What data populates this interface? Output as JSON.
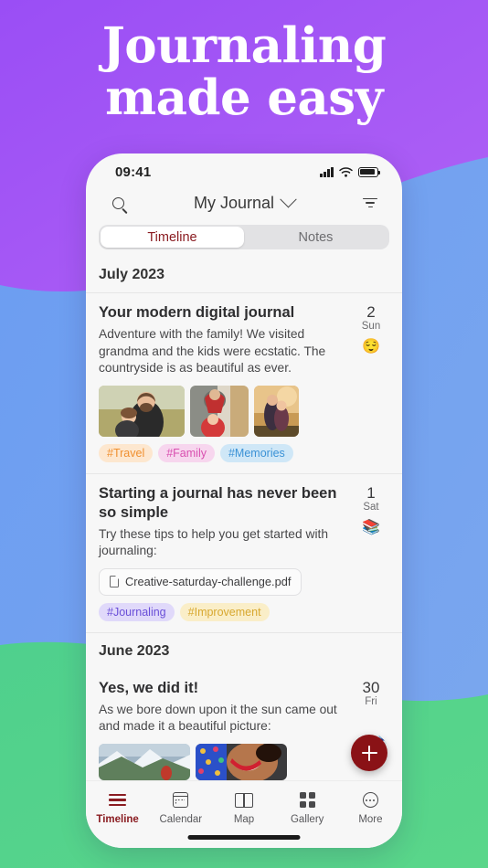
{
  "promo": {
    "headline_line1": "Journaling",
    "headline_line2": "made easy",
    "bg_purple": "#a855f5",
    "bg_blue": "#6f9ef0",
    "bg_green": "#56d189"
  },
  "status_bar": {
    "time": "09:41",
    "icons": [
      "cellular-signal",
      "wifi",
      "battery"
    ]
  },
  "nav": {
    "title": "My Journal",
    "chevron": "chevron-down",
    "search_icon": "search-icon",
    "filter_icon": "filter-icon"
  },
  "segmented": {
    "tabs": [
      {
        "label": "Timeline",
        "active": true
      },
      {
        "label": "Notes",
        "active": false
      }
    ],
    "active_color": "#8a1c21"
  },
  "feed": {
    "sections": [
      {
        "month": "July 2023",
        "entries": [
          {
            "title": "Your modern digital journal",
            "body": "Adventure with the family! We visited grandma and the kids were ecstatic. The countryside is as beautiful as ever.",
            "day_number": "2",
            "day_name": "Sun",
            "mood_emoji": "😌",
            "photos": [
              "family-father-daughter-field",
              "mother-child-kitchen",
              "siblings-sunset-hug"
            ],
            "tags": [
              {
                "label": "#Travel",
                "color": "#f09030",
                "bg": "#fde7cf"
              },
              {
                "label": "#Family",
                "color": "#d94fb0",
                "bg": "#f7d6ee"
              },
              {
                "label": "#Memories",
                "color": "#3b92d6",
                "bg": "#cfe7f7"
              }
            ]
          },
          {
            "title": "Starting a journal has never been so simple",
            "body": "Try these tips to help you get started with journaling:",
            "day_number": "1",
            "day_name": "Sat",
            "mood_emoji": "📚",
            "attachment": "Creative-saturday-challenge.pdf",
            "tags": [
              {
                "label": "#Journaling",
                "color": "#6a4fd8",
                "bg": "#e0d9fa"
              },
              {
                "label": "#Improvement",
                "color": "#d8a830",
                "bg": "#faeec8"
              }
            ]
          }
        ]
      },
      {
        "month": "June 2023",
        "entries": [
          {
            "title": "Yes, we did it!",
            "body": "As we bore down upon it the sun came out and made it a beautiful picture:",
            "day_number": "30",
            "day_name": "Fri",
            "photos": [
              "snowy-mountain-hiker",
              "smiling-woman-portrait"
            ],
            "tags": []
          }
        ]
      }
    ]
  },
  "fab": {
    "label": "+",
    "color": "#8a1216",
    "emoji": "🗻"
  },
  "tabbar": {
    "items": [
      {
        "label": "Timeline",
        "icon": "timeline-icon",
        "active": true
      },
      {
        "label": "Calendar",
        "icon": "calendar-icon",
        "active": false
      },
      {
        "label": "Map",
        "icon": "map-icon",
        "active": false
      },
      {
        "label": "Gallery",
        "icon": "gallery-grid-icon",
        "active": false
      },
      {
        "label": "More",
        "icon": "more-ellipsis-icon",
        "active": false
      }
    ]
  }
}
